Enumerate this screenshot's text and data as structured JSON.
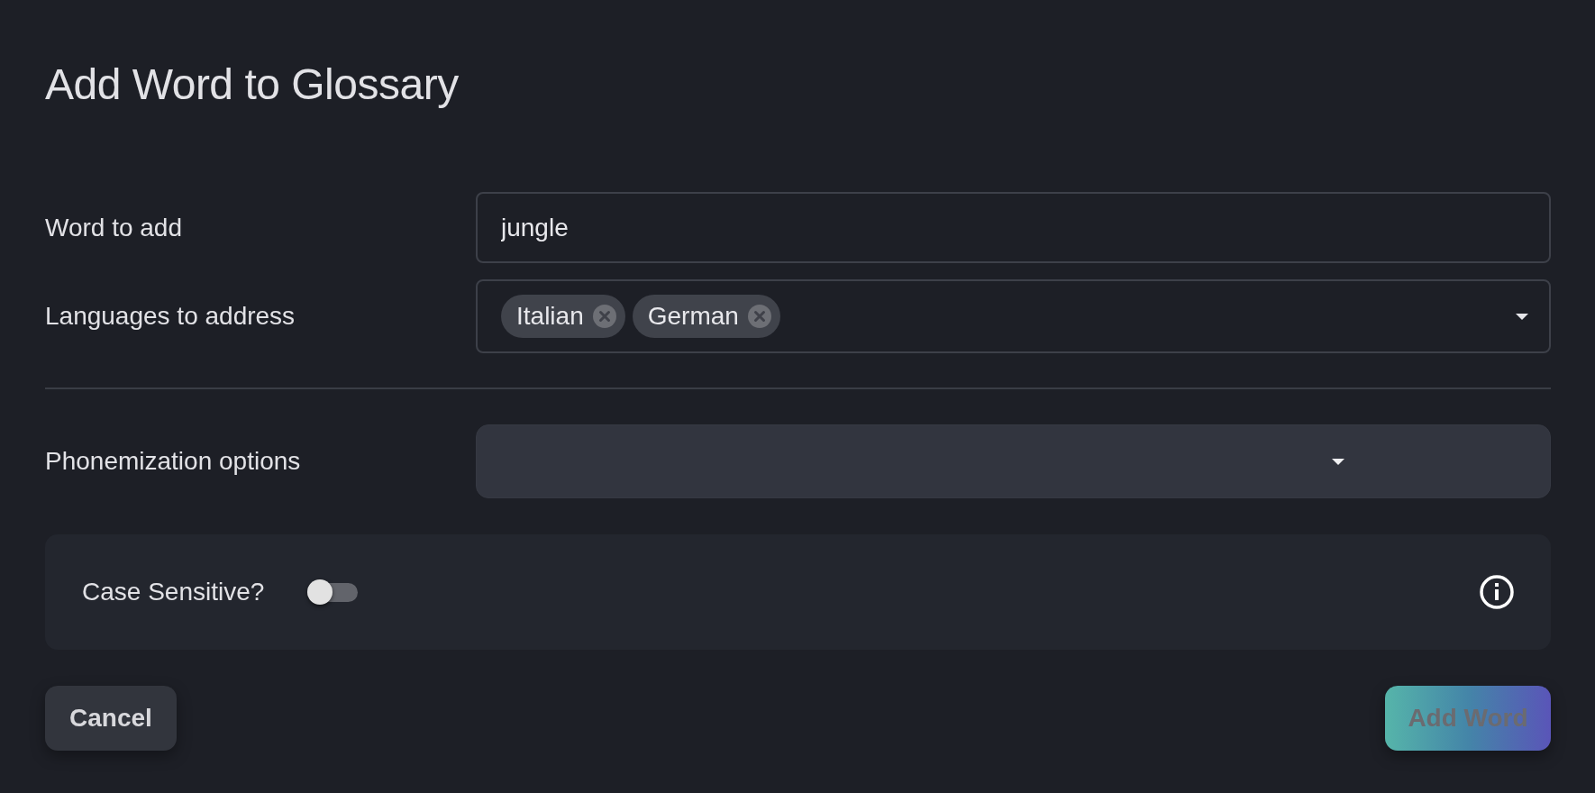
{
  "title": "Add Word to Glossary",
  "word": {
    "label": "Word to add",
    "value": "jungle"
  },
  "languages": {
    "label": "Languages to address",
    "tags": [
      "Italian",
      "German"
    ]
  },
  "phonemization": {
    "label": "Phonemization options"
  },
  "case_sensitive": {
    "label": "Case Sensitive?",
    "on": false
  },
  "cancel": {
    "label": "Cancel"
  },
  "submit": {
    "label": "Add Word",
    "disabled": true
  }
}
